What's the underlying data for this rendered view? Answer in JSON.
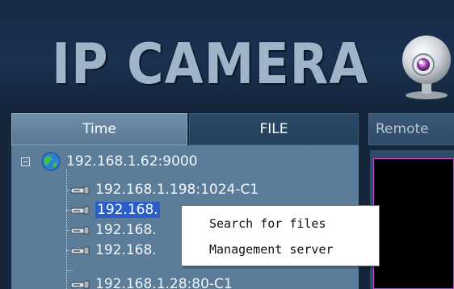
{
  "header": {
    "brand_text": "IP CAMERA",
    "camera_icon": "webcam-icon"
  },
  "tabs": [
    {
      "label": "Time",
      "active": true
    },
    {
      "label": "FILE",
      "active": false
    },
    {
      "label": "Remote",
      "active": false
    }
  ],
  "tree": {
    "root": {
      "label": "192.168.1.62:9000",
      "icon": "globe-icon",
      "expanded": true
    },
    "children": [
      {
        "label": "192.168.1.198:1024-C1",
        "icon": "camera-device-icon"
      },
      {
        "label": "192.168.",
        "icon": "camera-device-icon",
        "selected": true
      },
      {
        "label": "192.168.",
        "icon": "camera-device-icon"
      },
      {
        "label": "192.168.",
        "icon": "camera-device-icon"
      },
      {
        "label": "192.168.1.28:80-C1",
        "icon": "camera-device-icon"
      }
    ]
  },
  "context_menu": {
    "items": [
      {
        "label": "Search for files"
      },
      {
        "label": "Management server"
      }
    ]
  },
  "colors": {
    "background": "#15253a",
    "tree_panel": "#5b7d99",
    "selection": "#2a5ec8",
    "video_border": "#c548d0"
  }
}
